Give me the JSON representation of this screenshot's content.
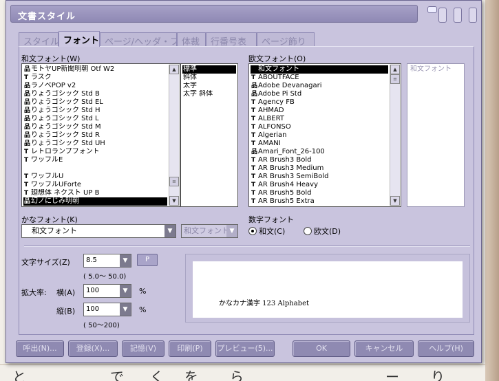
{
  "background": {
    "document_chars": [
      "と",
      "で",
      "く",
      "を",
      "ら",
      "ー",
      "り"
    ]
  },
  "dialog": {
    "title": "文書スタイル",
    "tabs": [
      {
        "label": "スタイル",
        "active": false
      },
      {
        "label": "フォント",
        "active": true
      },
      {
        "label": "ページ/ヘッダ・フ",
        "active": false
      },
      {
        "label": "体裁",
        "active": false
      },
      {
        "label": "行番号表",
        "active": false
      },
      {
        "label": "ページ飾り",
        "active": false
      }
    ]
  },
  "japanese_font": {
    "label": "和文フォント(W)",
    "items": [
      {
        "icon": "printer-font-icon",
        "name": "モトヤUP新聞明朝 Otf W2"
      },
      {
        "icon": "truetype-icon",
        "name": "ラスク"
      },
      {
        "icon": "printer-font-icon",
        "name": "ラノベPOP v2"
      },
      {
        "icon": "printer-font-icon",
        "name": "りょうゴシック Std B"
      },
      {
        "icon": "printer-font-icon",
        "name": "りょうゴシック Std EL"
      },
      {
        "icon": "printer-font-icon",
        "name": "りょうゴシック Std H"
      },
      {
        "icon": "printer-font-icon",
        "name": "りょうゴシック Std L"
      },
      {
        "icon": "printer-font-icon",
        "name": "りょうゴシック Std M"
      },
      {
        "icon": "printer-font-icon",
        "name": "りょうゴシック Std R"
      },
      {
        "icon": "printer-font-icon",
        "name": "りょうゴシック Std UH"
      },
      {
        "icon": "truetype-icon",
        "name": "レトロランプフォント"
      },
      {
        "icon": "truetype-icon",
        "name": "ワッフルE"
      },
      {
        "icon": "",
        "name": ""
      },
      {
        "icon": "truetype-icon",
        "name": "ワッフルU"
      },
      {
        "icon": "truetype-icon",
        "name": "ワッフルUForte"
      },
      {
        "icon": "truetype-icon",
        "name": "廻想体 ネクスト UP B"
      },
      {
        "icon": "printer-font-icon",
        "name": "幻ノにじみ明朝"
      }
    ],
    "selected_index": 16
  },
  "style_list": {
    "items": [
      "標準",
      "斜体",
      "太字",
      "太字 斜体"
    ],
    "selected_index": 0
  },
  "western_font": {
    "label": "欧文フォント(O)",
    "items": [
      {
        "icon": "",
        "name": "和文フォント"
      },
      {
        "icon": "truetype-icon",
        "name": "ABOUTFACE"
      },
      {
        "icon": "printer-font-icon",
        "name": "Adobe Devanagari"
      },
      {
        "icon": "printer-font-icon",
        "name": "Adobe Pi Std"
      },
      {
        "icon": "truetype-icon",
        "name": "Agency FB"
      },
      {
        "icon": "truetype-icon",
        "name": "AHMAD"
      },
      {
        "icon": "truetype-icon",
        "name": "ALBERT"
      },
      {
        "icon": "truetype-icon",
        "name": "ALFONSO"
      },
      {
        "icon": "truetype-icon",
        "name": "Algerian"
      },
      {
        "icon": "truetype-icon",
        "name": "AMANI"
      },
      {
        "icon": "printer-font-icon",
        "name": "Amari_Font_26-100"
      },
      {
        "icon": "truetype-icon",
        "name": "AR Brush3 Bold"
      },
      {
        "icon": "truetype-icon",
        "name": "AR Brush3 Medium"
      },
      {
        "icon": "truetype-icon",
        "name": "AR Brush3 SemiBold"
      },
      {
        "icon": "truetype-icon",
        "name": "AR Brush4 Heavy"
      },
      {
        "icon": "truetype-icon",
        "name": "AR Brush5 Bold"
      },
      {
        "icon": "truetype-icon",
        "name": "AR Brush5 Extra"
      }
    ],
    "selected_index": 0,
    "style_list_item": "和文フォント"
  },
  "kana_font": {
    "label": "かなフォント(K)",
    "value": "和文フォント",
    "style_value": "和文フォント"
  },
  "number_font": {
    "label": "数字フォント",
    "options": [
      "和文(C)",
      "欧文(D)"
    ],
    "selected_index": 0
  },
  "size": {
    "label": "文字サイズ(Z)",
    "value": "8.5",
    "p_button": "P",
    "range": "(     5.0〜     50.0)"
  },
  "scale": {
    "label": "拡大率:",
    "h_label": "横(A)",
    "h_value": "100",
    "v_label": "縦(B)",
    "v_value": "100",
    "unit": "%",
    "range": "( 50〜200)"
  },
  "preview": {
    "text": "かなカナ漢字 123 Alphabet"
  },
  "buttons": {
    "recall": "呼出(N)...",
    "register": "登録(X)...",
    "memory": "記憶(V)",
    "print": "印刷(P)",
    "preview": "プレビュー(5)...",
    "ok": "OK",
    "cancel": "キャンセル",
    "help": "ヘルプ(H)"
  },
  "icons": {
    "truetype_glyph": "T",
    "printer_glyph": "品",
    "scroll_up": "▲",
    "scroll_down": "▼",
    "thumb": "≡",
    "dropdown": "▼"
  }
}
